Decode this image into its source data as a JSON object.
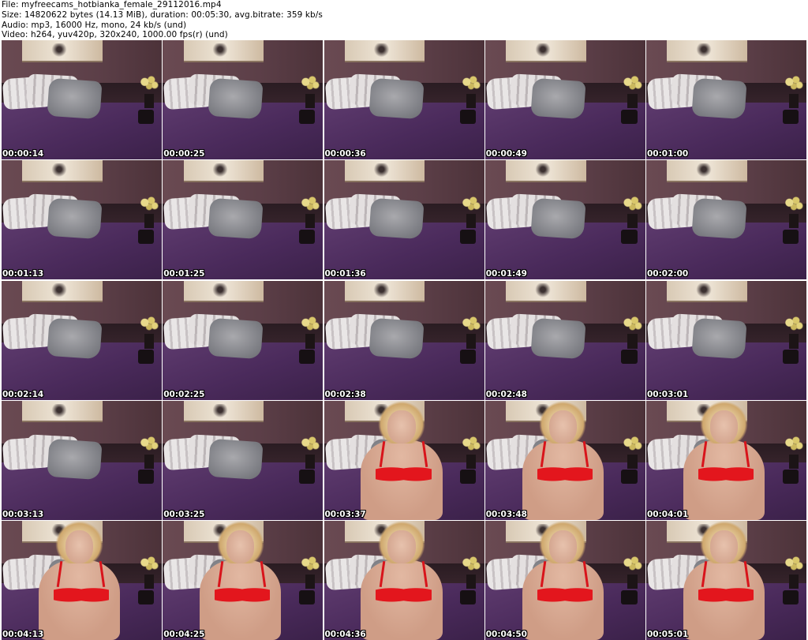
{
  "header": {
    "file_line": "File: myfreecams_hotbianka_female_29112016.mp4",
    "size_line": "Size: 14820622 bytes (14.13 MiB), duration: 00:05:30, avg.bitrate: 359 kb/s",
    "audio_line": "Audio: mp3, 16000 Hz, mono, 24 kb/s (und)",
    "video_line": "Video: h264, yuv420p, 320x240, 1000.00 fps(r) (und)"
  },
  "thumbnails": [
    {
      "timestamp": "00:00:14",
      "person": false
    },
    {
      "timestamp": "00:00:25",
      "person": false
    },
    {
      "timestamp": "00:00:36",
      "person": false
    },
    {
      "timestamp": "00:00:49",
      "person": false
    },
    {
      "timestamp": "00:01:00",
      "person": false
    },
    {
      "timestamp": "00:01:13",
      "person": false
    },
    {
      "timestamp": "00:01:25",
      "person": false
    },
    {
      "timestamp": "00:01:36",
      "person": false
    },
    {
      "timestamp": "00:01:49",
      "person": false
    },
    {
      "timestamp": "00:02:00",
      "person": false
    },
    {
      "timestamp": "00:02:14",
      "person": false
    },
    {
      "timestamp": "00:02:25",
      "person": false
    },
    {
      "timestamp": "00:02:38",
      "person": false
    },
    {
      "timestamp": "00:02:48",
      "person": false
    },
    {
      "timestamp": "00:03:01",
      "person": false
    },
    {
      "timestamp": "00:03:13",
      "person": false
    },
    {
      "timestamp": "00:03:25",
      "person": false
    },
    {
      "timestamp": "00:03:37",
      "person": true
    },
    {
      "timestamp": "00:03:48",
      "person": true
    },
    {
      "timestamp": "00:04:01",
      "person": true
    },
    {
      "timestamp": "00:04:13",
      "person": true
    },
    {
      "timestamp": "00:04:25",
      "person": true
    },
    {
      "timestamp": "00:04:36",
      "person": true
    },
    {
      "timestamp": "00:04:50",
      "person": true
    },
    {
      "timestamp": "00:05:01",
      "person": true
    }
  ]
}
